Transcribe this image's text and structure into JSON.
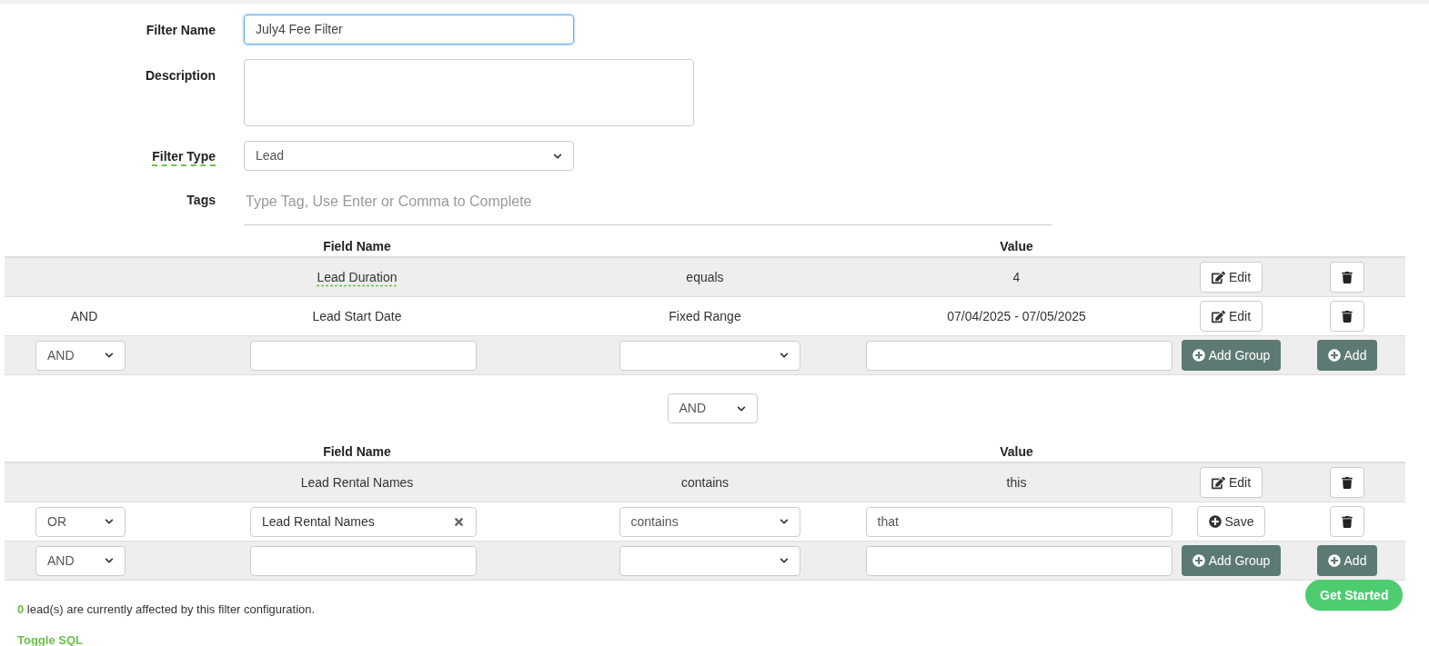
{
  "form": {
    "filter_name": {
      "label": "Filter Name",
      "value": "July4 Fee Filter",
      "focused": true
    },
    "description": {
      "label": "Description"
    },
    "filter_type": {
      "label": "Filter Type",
      "value": "Lead",
      "hint": true
    },
    "tags": {
      "label": "Tags",
      "placeholder": "Type Tag, Use Enter or Comma to Complete"
    }
  },
  "groups": [
    {
      "columns": {
        "field_name": "Field Name",
        "value": "Value"
      },
      "rows": [
        {
          "kind": "rule",
          "field": "Lead Duration",
          "hint": true,
          "operator": "equals",
          "value": "4",
          "actions": [
            {
              "kind": "edit",
              "label": "Edit"
            },
            {
              "kind": "delete"
            }
          ]
        },
        {
          "kind": "rule",
          "connector": "AND",
          "field": "Lead Start Date",
          "hint": false,
          "operator": "Fixed Range",
          "value": "07/04/2025 - 07/05/2025",
          "actions": [
            {
              "kind": "edit",
              "label": "Edit"
            },
            {
              "kind": "delete"
            }
          ]
        },
        {
          "kind": "input",
          "connector": "AND",
          "actions": [
            {
              "kind": "add-group",
              "label": "Add Group"
            },
            {
              "kind": "add",
              "label": "Add"
            }
          ]
        }
      ]
    },
    {
      "connector": "AND",
      "columns": {
        "field_name": "Field Name",
        "value": "Value"
      },
      "rows": [
        {
          "kind": "rule",
          "field": "Lead Rental Names",
          "hint": false,
          "operator": "contains",
          "value": "this",
          "actions": [
            {
              "kind": "edit",
              "label": "Edit"
            },
            {
              "kind": "delete"
            }
          ]
        },
        {
          "kind": "input",
          "connector": "OR",
          "field": "Lead Rental Names",
          "operator": "contains",
          "value": "that",
          "actions": [
            {
              "kind": "save",
              "label": "Save"
            },
            {
              "kind": "delete"
            }
          ]
        },
        {
          "kind": "input",
          "connector": "AND",
          "actions": [
            {
              "kind": "add-group",
              "label": "Add Group"
            },
            {
              "kind": "add",
              "label": "Add"
            }
          ]
        }
      ]
    }
  ],
  "footer": {
    "count": "0",
    "message": "lead(s) are currently affected by this filter configuration.",
    "toggle_link": "Toggle SQL"
  },
  "get_started": "Get Started"
}
